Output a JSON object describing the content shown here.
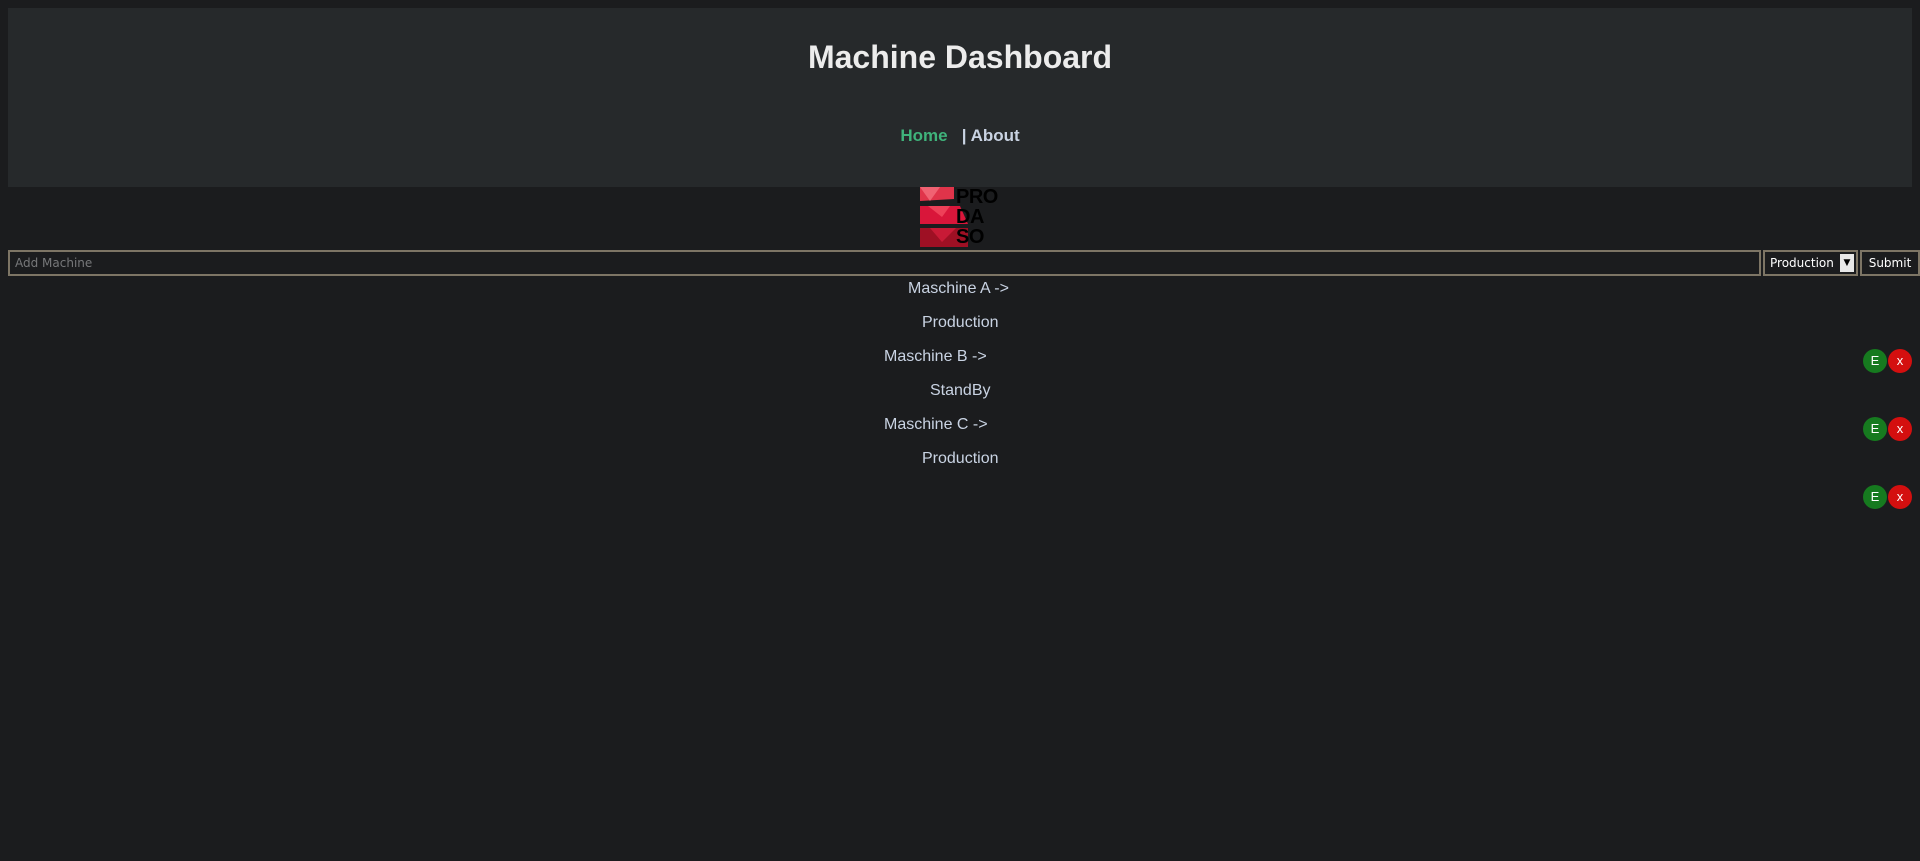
{
  "header": {
    "title": "Machine Dashboard",
    "nav": {
      "home": "Home",
      "separator": "|",
      "about": "About"
    }
  },
  "logo": {
    "lines": [
      "PRO",
      "DA",
      "SO"
    ]
  },
  "add_form": {
    "placeholder": "Add Machine",
    "status_select": "Production",
    "submit_label": "Submit"
  },
  "machines": [
    {
      "name": "Maschine A ->",
      "status": "Production",
      "edit_label": "E",
      "delete_label": "x"
    },
    {
      "name": "Maschine B ->",
      "status": "StandBy",
      "edit_label": "E",
      "delete_label": "x"
    },
    {
      "name": "Maschine C ->",
      "status": "Production",
      "edit_label": "E",
      "delete_label": "x"
    }
  ],
  "colors": {
    "background": "#1b1c1e",
    "header": "#26292b",
    "nav_active": "#3fb37b",
    "text": "#c9d3e3",
    "edit_button": "#167a1f",
    "delete_button": "#d40f0f"
  }
}
